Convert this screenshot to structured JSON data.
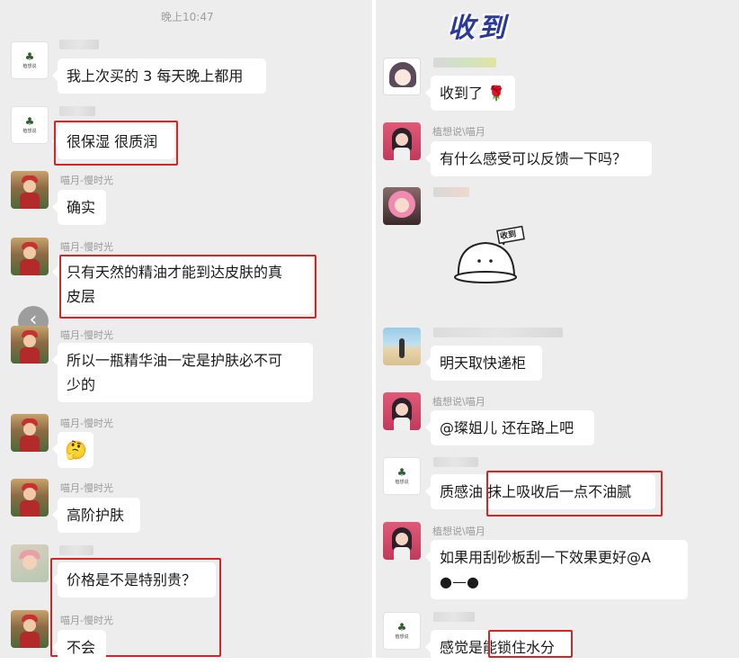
{
  "left": {
    "timestamp": "晚上10:47",
    "messages": [
      {
        "sender": "",
        "text": "我上次买的 3 每天晚上都用"
      },
      {
        "sender": "",
        "text": "很保湿 很质润"
      },
      {
        "sender": "喵月-慢时光",
        "text": "确实"
      },
      {
        "sender": "喵月-慢时光",
        "text_line1": "只有天然的精油才能到达皮肤的真",
        "text_line2": "皮层"
      },
      {
        "sender": "喵月-慢时光",
        "text_line1": "所以一瓶精华油一定是护肤必不可",
        "text_line2": "少的"
      },
      {
        "sender": "喵月-慢时光",
        "emoji": "🤔"
      },
      {
        "sender": "喵月-慢时光",
        "text": "高阶护肤"
      },
      {
        "sender": "",
        "text": "价格是不是特别贵？"
      },
      {
        "sender": "喵月-慢时光",
        "text": "不会"
      }
    ],
    "back_button": "‹"
  },
  "right": {
    "sticker_top": "收到",
    "messages": [
      {
        "sender": "",
        "text": "收到了",
        "emoji": "🌹"
      },
      {
        "sender": "植想说\\喵月",
        "text": "有什么感受可以反馈一下吗？"
      },
      {
        "sender": "",
        "sticker_text": "收到"
      },
      {
        "sender": "",
        "text": "明天取快递柜"
      },
      {
        "sender": "植想说\\喵月",
        "text": "@璨姐儿 还在路上吧"
      },
      {
        "sender": "",
        "text": "质感油 抹上吸收后一点不油腻"
      },
      {
        "sender": "植想说\\喵月",
        "text_line1": "如果用刮砂板刮一下效果更好@A",
        "text_line2": "●—●"
      },
      {
        "sender": "",
        "text": "感觉是能锁住水分"
      }
    ]
  },
  "logo_text": "植想说",
  "colors": {
    "highlight": "#d62525",
    "chat_bg": "#ededed",
    "bubble": "#ffffff"
  }
}
